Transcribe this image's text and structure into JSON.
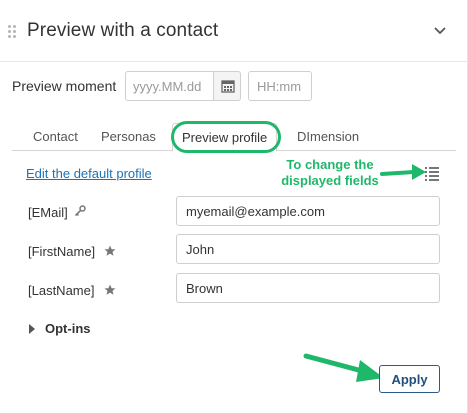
{
  "panel": {
    "title": "Preview with a contact"
  },
  "preview_moment": {
    "label": "Preview moment",
    "date_placeholder": "yyyy.MM.dd",
    "date_value": "",
    "time_placeholder": "HH:mm",
    "time_value": ""
  },
  "tabs": [
    {
      "label": "Contact",
      "active": false
    },
    {
      "label": "Personas",
      "active": false
    },
    {
      "label": "Preview profile",
      "active": true
    },
    {
      "label": "DImension",
      "active": false
    }
  ],
  "profile": {
    "edit_link": "Edit the default profile",
    "annotation": "To change the displayed fields",
    "fields": [
      {
        "label": "[EMail]",
        "icon": "key-icon",
        "value": "myemail@example.com"
      },
      {
        "label": "[FirstName]",
        "icon": "star-icon",
        "value": "John"
      },
      {
        "label": "[LastName]",
        "icon": "star-icon",
        "value": "Brown"
      }
    ],
    "optins_label": "Opt-ins"
  },
  "actions": {
    "apply_label": "Apply"
  },
  "colors": {
    "annotation_green": "#1fb86b",
    "link_blue": "#1a73b5",
    "button_border": "#2a5a8a"
  }
}
